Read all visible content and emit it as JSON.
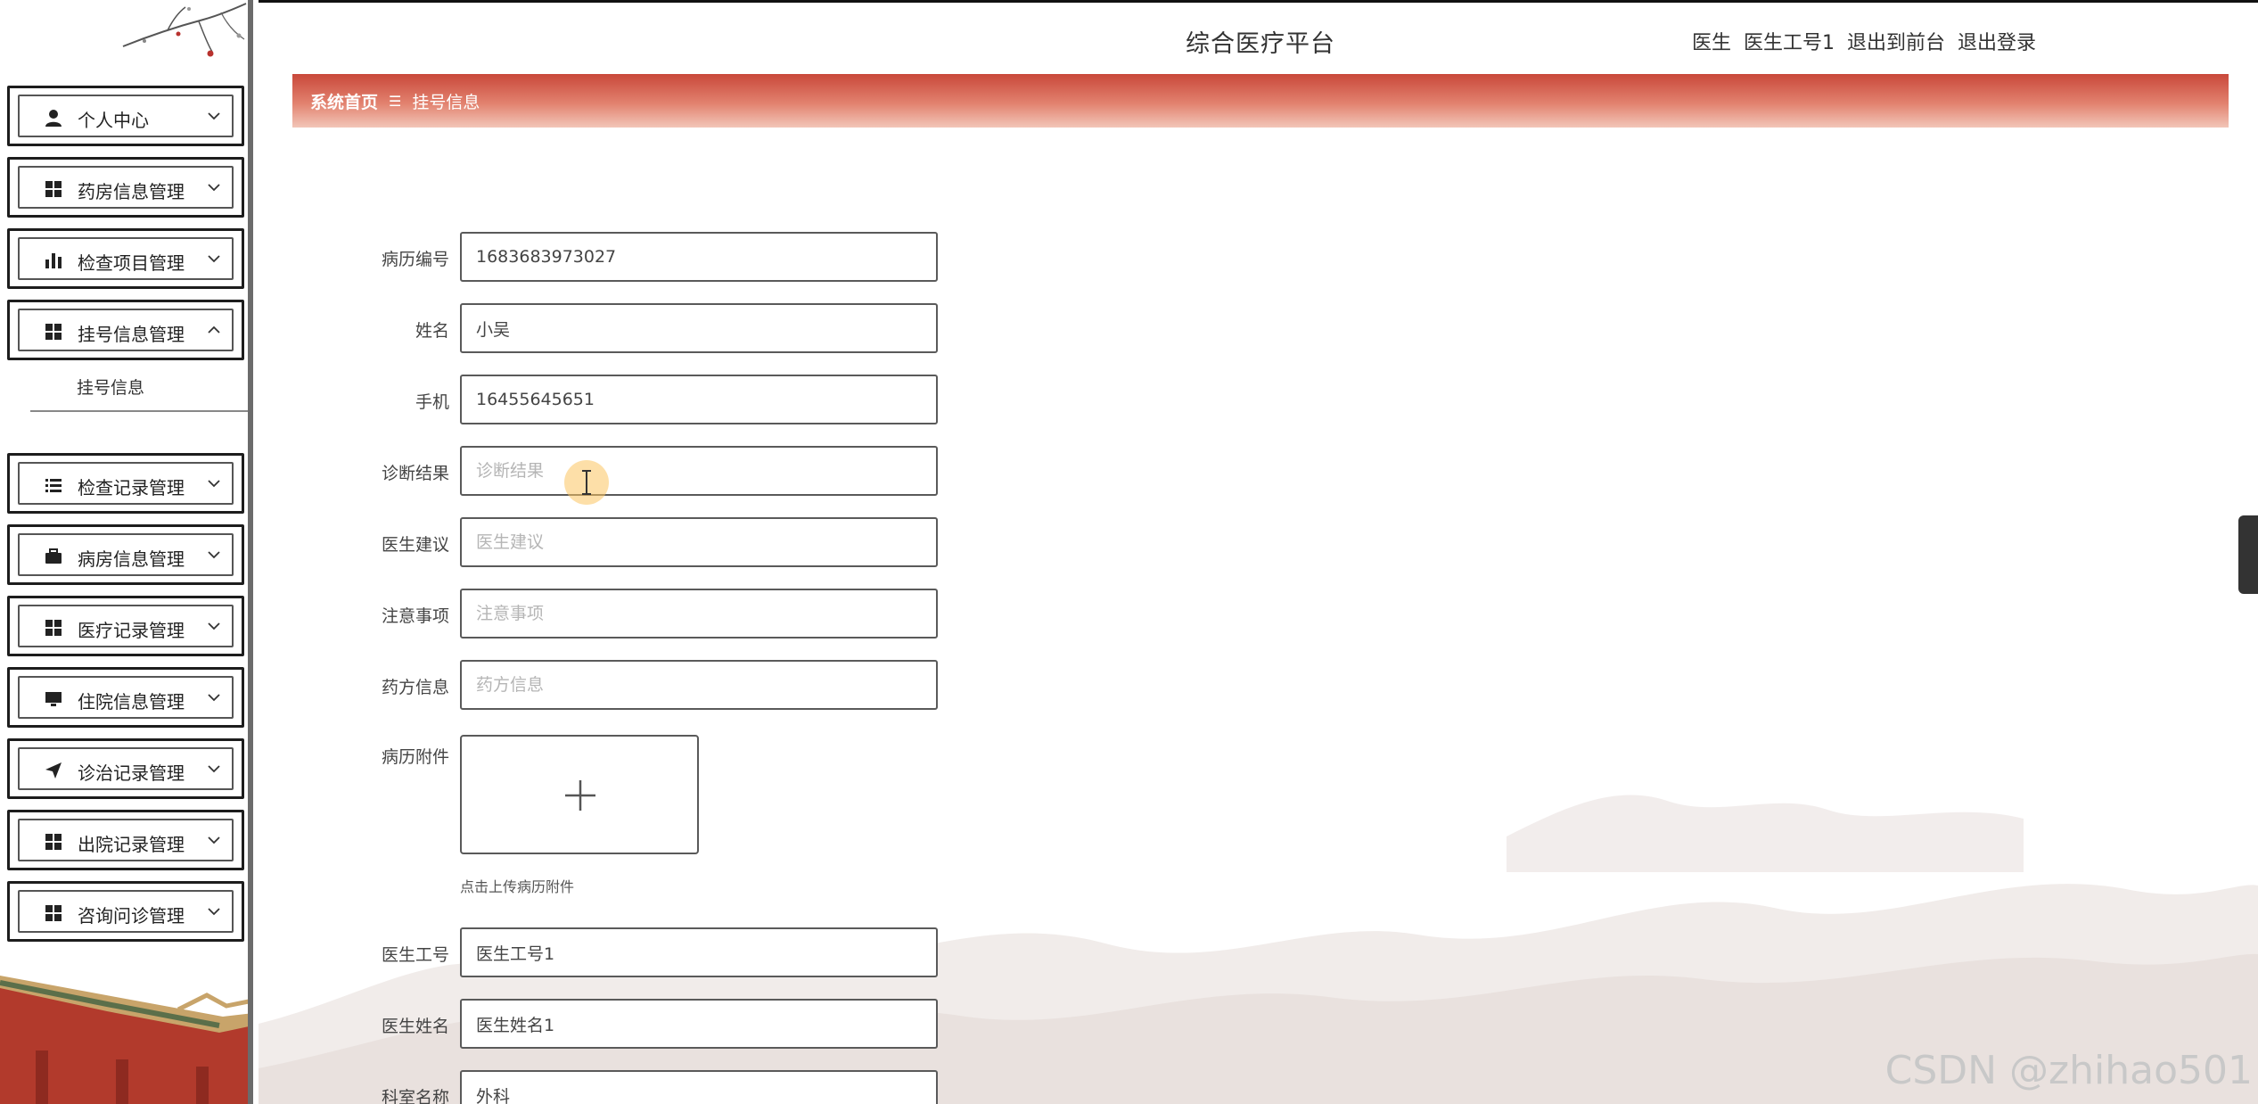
{
  "header": {
    "title": "综合医疗平台",
    "user_role": "医生",
    "user_name": "医生工号1",
    "to_front_label": "退出到前台",
    "logout_label": "退出登录"
  },
  "breadcrumb": {
    "home": "系统首页",
    "separator": "☰",
    "current": "挂号信息"
  },
  "sidebar": {
    "items": [
      {
        "label": "个人中心",
        "icon": "user-icon",
        "expanded": false
      },
      {
        "label": "药房信息管理",
        "icon": "grid-icon",
        "expanded": false
      },
      {
        "label": "检查项目管理",
        "icon": "bar-chart-icon",
        "expanded": false
      },
      {
        "label": "挂号信息管理",
        "icon": "grid-icon",
        "expanded": true
      },
      {
        "label": "检查记录管理",
        "icon": "list-icon",
        "expanded": false
      },
      {
        "label": "病房信息管理",
        "icon": "briefcase-icon",
        "expanded": false
      },
      {
        "label": "医疗记录管理",
        "icon": "grid-icon",
        "expanded": false
      },
      {
        "label": "住院信息管理",
        "icon": "monitor-icon",
        "expanded": false
      },
      {
        "label": "诊治记录管理",
        "icon": "send-icon",
        "expanded": false
      },
      {
        "label": "出院记录管理",
        "icon": "grid-icon",
        "expanded": false
      },
      {
        "label": "咨询问诊管理",
        "icon": "grid-icon",
        "expanded": false
      }
    ],
    "submenu_label": "挂号信息"
  },
  "form": {
    "record_no": {
      "label": "病历编号",
      "value": "1683683973027",
      "placeholder": ""
    },
    "name": {
      "label": "姓名",
      "value": "小吴",
      "placeholder": ""
    },
    "phone": {
      "label": "手机",
      "value": "16455645651",
      "placeholder": ""
    },
    "diagnosis": {
      "label": "诊断结果",
      "value": "",
      "placeholder": "诊断结果"
    },
    "advice": {
      "label": "医生建议",
      "value": "",
      "placeholder": "医生建议"
    },
    "notes": {
      "label": "注意事项",
      "value": "",
      "placeholder": "注意事项"
    },
    "prescription": {
      "label": "药方信息",
      "value": "",
      "placeholder": "药方信息"
    },
    "attachment": {
      "label": "病历附件",
      "hint": "点击上传病历附件"
    },
    "doctor_no": {
      "label": "医生工号",
      "value": "医生工号1",
      "placeholder": ""
    },
    "doctor_name": {
      "label": "医生姓名",
      "value": "医生姓名1",
      "placeholder": ""
    },
    "department": {
      "label": "科室名称",
      "value": "外科",
      "placeholder": ""
    }
  },
  "watermark": "CSDN @zhihao501",
  "colors": {
    "breadcrumb_start": "#c9483a",
    "breadcrumb_end": "#f2c6b8",
    "border": "#5a5a5a",
    "sidebar_edge": "#6b6b6b"
  }
}
